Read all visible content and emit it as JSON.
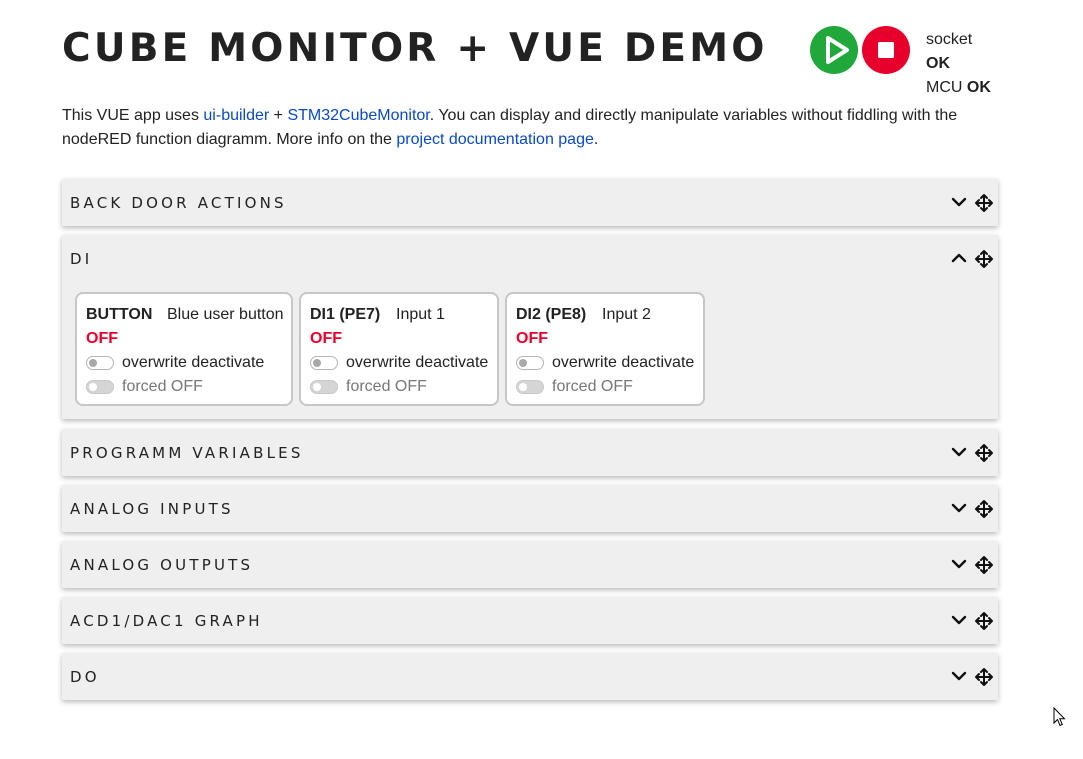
{
  "header": {
    "title": "CUBE MONITOR + VUE DEMO",
    "play_icon": "play-icon",
    "stop_icon": "stop-icon",
    "socket_label": "socket",
    "socket_status": "OK",
    "mcu_label": "MCU",
    "mcu_status": "OK"
  },
  "description": {
    "part1": "This VUE app uses ",
    "link_uibuilder": "ui-builder",
    "part2": " + ",
    "link_cubemonitor": "STM32CubeMonitor",
    "part3": ". You can display and directly manipulate variables without fiddling with the nodeRED function diagramm. More info on the ",
    "link_docs": "project documentation page",
    "part4": "."
  },
  "panels": [
    {
      "title": "BACK DOOR ACTIONS",
      "expanded": false
    },
    {
      "title": "DI",
      "expanded": true
    },
    {
      "title": "PROGRAMM VARIABLES",
      "expanded": false
    },
    {
      "title": "ANALOG INPUTS",
      "expanded": false
    },
    {
      "title": "ANALOG OUTPUTS",
      "expanded": false
    },
    {
      "title": "ACD1/DAC1 GRAPH",
      "expanded": false
    },
    {
      "title": "DO",
      "expanded": false
    }
  ],
  "di_cards": [
    {
      "name": "BUTTON",
      "description": "Blue user button",
      "state": "OFF",
      "toggle1_label": "overwrite deactivate",
      "toggle2_label": "forced OFF"
    },
    {
      "name": "DI1 (PE7)",
      "description": "Input 1",
      "state": "OFF",
      "toggle1_label": "overwrite deactivate",
      "toggle2_label": "forced OFF"
    },
    {
      "name": "DI2 (PE8)",
      "description": "Input 2",
      "state": "OFF",
      "toggle1_label": "overwrite deactivate",
      "toggle2_label": "forced OFF"
    }
  ],
  "colors": {
    "play": "#21a83b",
    "stop": "#e8002d",
    "link": "#0a49c8",
    "off_state": "#e8002d",
    "panel_bg": "#efefef"
  }
}
